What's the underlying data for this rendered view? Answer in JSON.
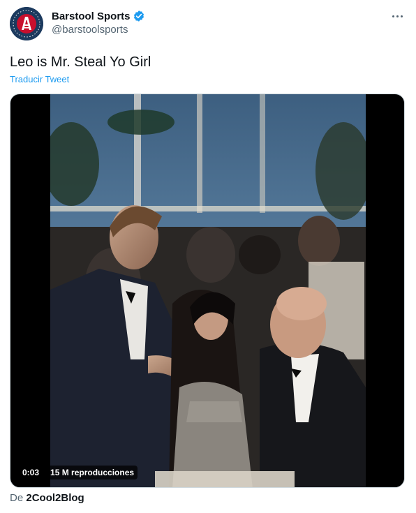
{
  "author": {
    "display_name": "Barstool Sports",
    "handle": "@barstoolsports",
    "verified": true,
    "avatar_icon": "barstool-logo-icon",
    "avatar_color": "#1c3a5e"
  },
  "menu": {
    "icon": "more-horizontal-icon"
  },
  "tweet": {
    "text": "Leo is Mr. Steal Yo Girl",
    "translate_label": "Traducir Tweet"
  },
  "media": {
    "type": "video",
    "elapsed": "0:03",
    "views": "15 M reproducciones"
  },
  "source": {
    "prefix": "De",
    "name": "2Cool2Blog"
  },
  "colors": {
    "accent": "#1d9bf0",
    "text": "#0f1419",
    "muted": "#536471"
  }
}
